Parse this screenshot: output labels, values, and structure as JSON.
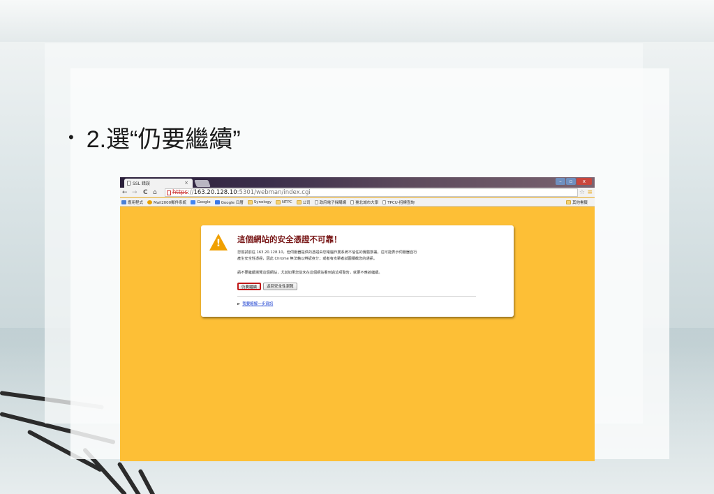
{
  "slide": {
    "bullet": "2.選“仍要繼續”"
  },
  "browser": {
    "tab_title": "SSL 錯誤",
    "tab_close": "×",
    "window_controls": {
      "minimize": "–",
      "maximize": "▫",
      "close": "x"
    },
    "url": {
      "scheme": "https",
      "separator": "://",
      "host": "163.20.128.10",
      "rest": ":5301/webman/index.cgi"
    },
    "nav": {
      "back": "←",
      "forward": "→",
      "reload": "C",
      "home": "⌂"
    },
    "bookmarks": [
      {
        "icon": "apps-icon",
        "label": "應用程式"
      },
      {
        "icon": "mail-icon",
        "label": "Mail2000郵件系統"
      },
      {
        "icon": "google-icon",
        "label": "Google"
      },
      {
        "icon": "calendar-icon",
        "label": "Google 日曆"
      },
      {
        "icon": "folder-icon",
        "label": "Synology"
      },
      {
        "icon": "folder-icon",
        "label": "NTPC"
      },
      {
        "icon": "folder-icon",
        "label": "公司"
      },
      {
        "icon": "page-icon",
        "label": "政府電子採購網"
      },
      {
        "icon": "page-icon",
        "label": "臺北城市大學"
      },
      {
        "icon": "page-icon",
        "label": "TPCU-招標查詢"
      }
    ],
    "other_bookmarks": "其他書籤"
  },
  "warning": {
    "title": "這個網站的安全憑證不可靠！",
    "body_line1": "您嘗試前往 163.20.128.10，但伺服器提供的憑證由您電腦作業系統不信任的實體簽署。這可能表示伺服器自行",
    "body_line2": "產生安全性憑證，因此 Chrome 無法藉以辨認身分；或者有攻擊者試圖攔截您的通訊。",
    "body_para2": "請不要繼續瀏覽這個網站，尤其如果您從未在這個網站看到過這項警告，就更不應該繼續。",
    "proceed_button": "仍要繼續",
    "back_button": "返回安全性瀏覽",
    "details_link": "我要瞭解一步資訊",
    "details_marker": "►"
  }
}
